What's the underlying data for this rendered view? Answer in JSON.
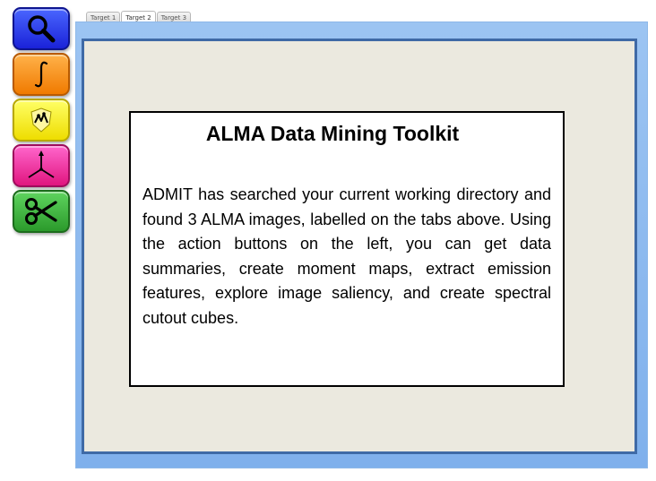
{
  "toolbar": {
    "buttons": [
      {
        "name": "search",
        "icon": "magnifier-icon",
        "color": "#2a34e8"
      },
      {
        "name": "integrate",
        "icon": "integral-icon",
        "color": "#f88a10"
      },
      {
        "name": "features",
        "icon": "emission-features-icon",
        "color": "#f4ee10"
      },
      {
        "name": "saliency",
        "icon": "axes-icon",
        "color": "#ee2a96"
      },
      {
        "name": "cutout",
        "icon": "scissors-icon",
        "color": "#39a839"
      }
    ]
  },
  "tabs": [
    {
      "label": "Target 1",
      "active": false
    },
    {
      "label": "Target 2",
      "active": true
    },
    {
      "label": "Target 3",
      "active": false
    }
  ],
  "message": {
    "title": "ALMA Data Mining Toolkit",
    "body": "ADMIT has searched your current working directory and found 3 ALMA images, labelled on the tabs above.  Using the action buttons on the left, you can get data summaries, create moment maps, extract emission features, explore image saliency, and create spectral cutout cubes."
  },
  "colors": {
    "panel_frame": "#8fbbee",
    "panel_border": "#3f6aa6",
    "panel_background": "#ebe9df",
    "message_background": "#ffffff"
  }
}
